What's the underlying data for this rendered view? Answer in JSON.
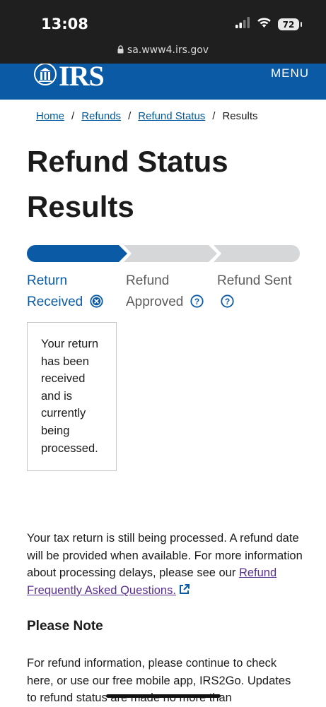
{
  "status_bar": {
    "time": "13:08",
    "battery": "72",
    "url": "sa.www4.irs.gov"
  },
  "header": {
    "logo_text": "IRS",
    "menu_label": "MENU",
    "brand_color": "#0a5aa5"
  },
  "breadcrumb": {
    "items": [
      "Home",
      "Refunds",
      "Refund Status"
    ],
    "separator": "/",
    "current": "Results"
  },
  "page": {
    "title": "Refund Status Results"
  },
  "progress": {
    "steps": [
      {
        "label": "Return Received",
        "state": "complete",
        "icon": "close-circle-icon"
      },
      {
        "label": "Refund Approved",
        "state": "pending",
        "icon": "help-circle-icon"
      },
      {
        "label": "Refund Sent",
        "state": "pending",
        "icon": "help-circle-icon"
      }
    ],
    "colors": {
      "active": "#0a5aa5",
      "inactive": "#d6d7d9"
    }
  },
  "status_box": {
    "text": "Your return has been received and is currently being processed."
  },
  "info": {
    "paragraph_text": "Your tax return is still being processed. A refund date will be provided when available. For more information about processing delays, please see our ",
    "faq_link": "Refund Frequently Asked Questions.",
    "note_heading": "Please Note",
    "note_text": "For refund information, please continue to check here, or use our free mobile app, IRS2Go. Updates to refund status are made no more than"
  }
}
